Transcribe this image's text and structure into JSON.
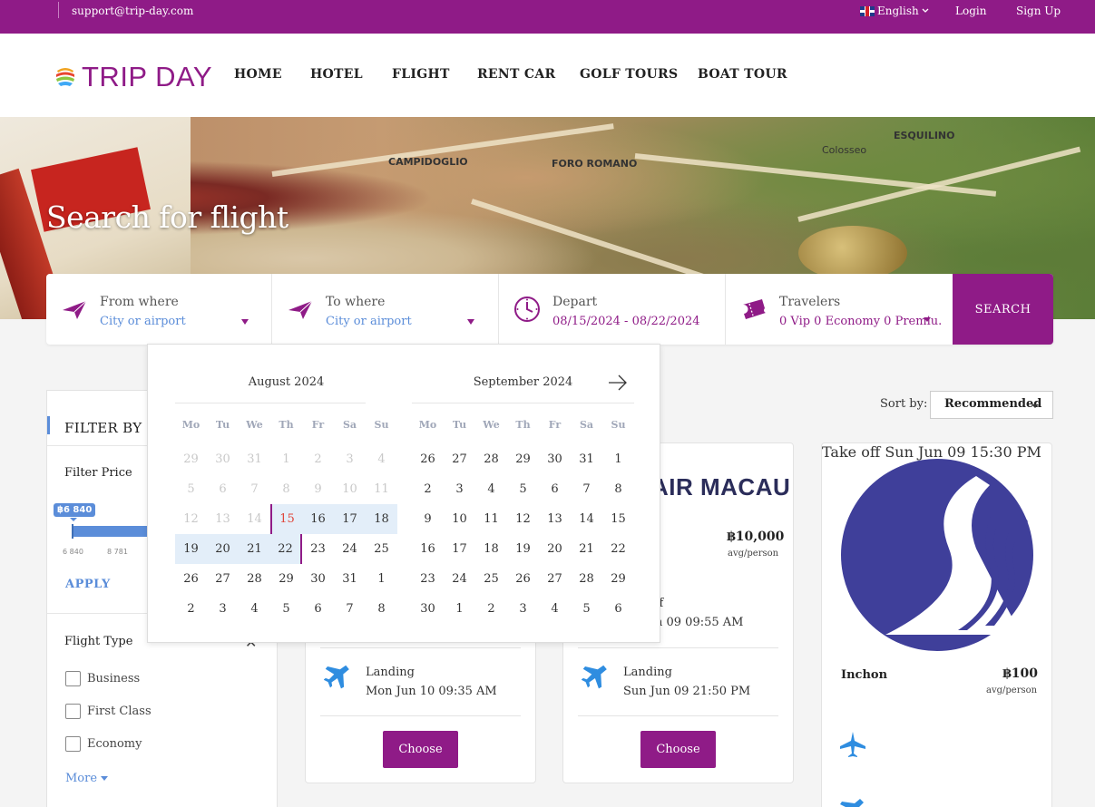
{
  "topbar": {
    "email": "support@trip-day.com",
    "language": "English",
    "login": "Login",
    "signup": "Sign Up"
  },
  "brand": {
    "name": "TRIP DAY"
  },
  "nav": [
    "HOME",
    "HOTEL",
    "FLIGHT",
    "RENT CAR",
    "GOLF TOURS",
    "BOAT TOUR"
  ],
  "hero": {
    "title": "Search for flight",
    "map_labels": [
      "CAMPIDOGLIO",
      "FORO ROMANO",
      "Colosseo",
      "ESQUILINO"
    ]
  },
  "search": {
    "from_label": "From where",
    "from_placeholder": "City or airport",
    "to_label": "To where",
    "to_placeholder": "City or airport",
    "depart_label": "Depart",
    "depart_value": "08/15/2024 - 08/22/2024",
    "travelers_label": "Travelers",
    "travelers_value": "0 Vip 0 Economy 0 Premiu.",
    "button": "SEARCH"
  },
  "calendar": {
    "weekdays": [
      "Mo",
      "Tu",
      "We",
      "Th",
      "Fr",
      "Sa",
      "Su"
    ],
    "months": [
      {
        "title": "August 2024",
        "weeks": [
          [
            "29",
            "30",
            "31",
            "1",
            "2",
            "3",
            "4"
          ],
          [
            "5",
            "6",
            "7",
            "8",
            "9",
            "10",
            "11"
          ],
          [
            "12",
            "13",
            "14",
            "15",
            "16",
            "17",
            "18"
          ],
          [
            "19",
            "20",
            "21",
            "22",
            "23",
            "24",
            "25"
          ],
          [
            "26",
            "27",
            "28",
            "29",
            "30",
            "31",
            "1"
          ],
          [
            "2",
            "3",
            "4",
            "5",
            "6",
            "7",
            "8"
          ]
        ]
      },
      {
        "title": "September 2024",
        "weeks": [
          [
            "26",
            "27",
            "28",
            "29",
            "30",
            "31",
            "1"
          ],
          [
            "2",
            "3",
            "4",
            "5",
            "6",
            "7",
            "8"
          ],
          [
            "9",
            "10",
            "11",
            "12",
            "13",
            "14",
            "15"
          ],
          [
            "16",
            "17",
            "18",
            "19",
            "20",
            "21",
            "22"
          ],
          [
            "23",
            "24",
            "25",
            "26",
            "27",
            "28",
            "29"
          ],
          [
            "30",
            "1",
            "2",
            "3",
            "4",
            "5",
            "6"
          ]
        ]
      }
    ],
    "selected_start": "15",
    "selected_end": "22"
  },
  "filters": {
    "title": "FILTER BY",
    "price_label": "Filter Price",
    "price_current": "฿6 840",
    "price_ticks": [
      "6 840",
      "8 781"
    ],
    "apply": "APPLY",
    "flight_type_label": "Flight Type",
    "flight_types": [
      "Business",
      "First Class",
      "Economy"
    ],
    "more": "More"
  },
  "sort": {
    "label": "Sort by:",
    "value": "Recommended"
  },
  "results": [
    {
      "landing_label": "Landing",
      "landing_time": "Mon Jun 10 09:35 AM",
      "choose": "Choose"
    },
    {
      "airline_name": "AIR MACAU",
      "price": "฿10,000",
      "per": "avg/person",
      "takeoff_partial_a": "ff",
      "takeoff_partial_b": "n 09 09:55 AM",
      "landing_label": "Landing",
      "landing_time": "Sun Jun 09 21:50 PM",
      "choose": "Choose"
    },
    {
      "city": "Inchon",
      "price": "฿100",
      "per": "avg/person",
      "takeoff_label": "Take off",
      "takeoff_time": "Sun Jun 09 15:30 PM"
    }
  ],
  "colors": {
    "brand": "#8f1b87",
    "accent": "#5b8dd9"
  }
}
